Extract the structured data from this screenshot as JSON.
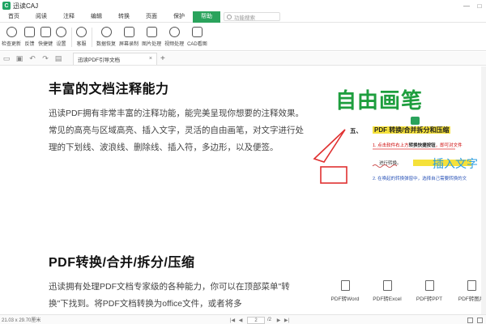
{
  "app": {
    "name": "迅读CAJ"
  },
  "window_controls": {
    "minimize": "—",
    "maximize": "□"
  },
  "menu": [
    {
      "label": "首页",
      "active": false
    },
    {
      "label": "阅读",
      "active": false
    },
    {
      "label": "注释",
      "active": false
    },
    {
      "label": "编辑",
      "active": false
    },
    {
      "label": "转换",
      "active": false
    },
    {
      "label": "页面",
      "active": false
    },
    {
      "label": "保护",
      "active": false
    },
    {
      "label": "帮助",
      "active": true
    }
  ],
  "func_search": {
    "placeholder": "功能搜索"
  },
  "ribbon": [
    {
      "label": "检查更新",
      "icon": "refresh-icon"
    },
    {
      "label": "反馈",
      "icon": "feedback-icon"
    },
    {
      "label": "快捷键",
      "icon": "keyboard-icon"
    },
    {
      "label": "设置",
      "icon": "gear-icon"
    },
    {
      "label": "客服",
      "icon": "headset-icon"
    },
    {
      "label": "数据恢复",
      "icon": "data-recovery-icon"
    },
    {
      "label": "屏幕录制",
      "icon": "screen-record-icon"
    },
    {
      "label": "图片处理",
      "icon": "image-process-icon"
    },
    {
      "label": "视频处理",
      "icon": "video-process-icon"
    },
    {
      "label": "CAD看图",
      "icon": "cad-viewer-icon"
    }
  ],
  "tab": {
    "title": "迅读PDF引导文档",
    "close": "×",
    "add": "+"
  },
  "doc": {
    "h1": "丰富的文档注释能力",
    "para1": "迅读PDF拥有非常丰富的注释功能，能完美呈现你想要的注释效果。常见的高亮与区域高亮、插入文字，灵活的自由画笔，对文字进行处理的下划线、波浪线、删除线、插入符，多边形，以及便签。",
    "h2": "PDF转换/合并/拆分/压缩",
    "para2": "迅读拥有处理PDF文档专家级的各种能力，你可以在顶部菜单\"转换\"下找到。将PDF文档转换为office文件，或者将多"
  },
  "illustration": {
    "free_draw": "自由画笔",
    "section_no": "五、",
    "section_title": "PDF 转换/合并拆分和压缩",
    "step1_prefix": "1. 点击软件右上方",
    "step1_bold": "转换快捷按钮",
    "step1_suffix": "，即可对文件",
    "step1b": "进行转换。",
    "insert_text": "插入文字",
    "step2": "2. 在唤起的转换弹窗中，选择自己需要转换的文"
  },
  "convert_tools": [
    {
      "label": "PDF转Word",
      "icon": "pdf-to-word-icon"
    },
    {
      "label": "PDF转Excel",
      "icon": "pdf-to-excel-icon"
    },
    {
      "label": "PDF转PPT",
      "icon": "pdf-to-ppt-icon"
    },
    {
      "label": "PDF转图片",
      "icon": "pdf-to-image-icon"
    }
  ],
  "status": {
    "page_size": "21.03 x 29.70厘米",
    "current_page": "2",
    "total_pages": "/2"
  },
  "colors": {
    "accent": "#2aa35c",
    "highlight": "#f5e13a",
    "insert_text": "#2b9de0"
  }
}
